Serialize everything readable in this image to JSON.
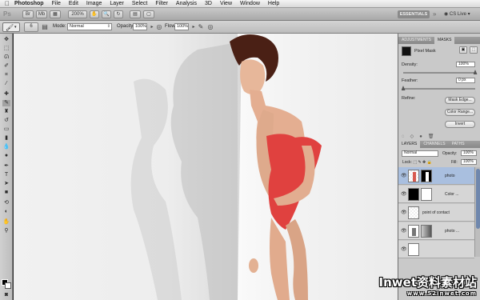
{
  "menubar": {
    "app_name": "Photoshop",
    "items": [
      "File",
      "Edit",
      "Image",
      "Layer",
      "Select",
      "Filter",
      "Analysis",
      "3D",
      "View",
      "Window",
      "Help"
    ]
  },
  "appbar": {
    "logo": "Ps",
    "zoom": "200%",
    "essentials": "ESSENTIALS",
    "cs_live": "CS Live"
  },
  "options": {
    "brush_size": "6",
    "mode_label": "Mode:",
    "mode_value": "Normal",
    "opacity_label": "Opacity:",
    "opacity_value": "100%",
    "flow_label": "Flow:",
    "flow_value": "100%"
  },
  "masks_panel": {
    "tabs": [
      "ADJUSTMENTS",
      "MASKS"
    ],
    "mask_type": "Pixel Mask",
    "density_label": "Density:",
    "density_value": "100%",
    "density_level": 1.0,
    "feather_label": "Feather:",
    "feather_value": "0 px",
    "feather_level": 0.0,
    "refine_label": "Refine:",
    "mask_edge_button": "Mask Edge...",
    "color_range_button": "Color Range...",
    "invert_button": "Invert"
  },
  "layers_panel": {
    "tabs": [
      "LAYERS",
      "CHANNELS",
      "PATHS"
    ],
    "blend_mode": "Normal",
    "opacity_label": "Opacity:",
    "opacity_value": "100%",
    "fill_label": "Fill:",
    "fill_value": "100%",
    "layers": [
      {
        "name": "photo",
        "selected": true
      },
      {
        "name": "Color ...",
        "selected": false
      },
      {
        "name": "point of contact",
        "selected": false
      },
      {
        "name": "photo ...",
        "selected": false
      }
    ]
  },
  "watermark": {
    "line1": "Inwet资料素材站",
    "line2": "www.52inwet.com"
  },
  "colors": {
    "swimsuit": "#e0413f",
    "selection": "#a9bfdf"
  }
}
